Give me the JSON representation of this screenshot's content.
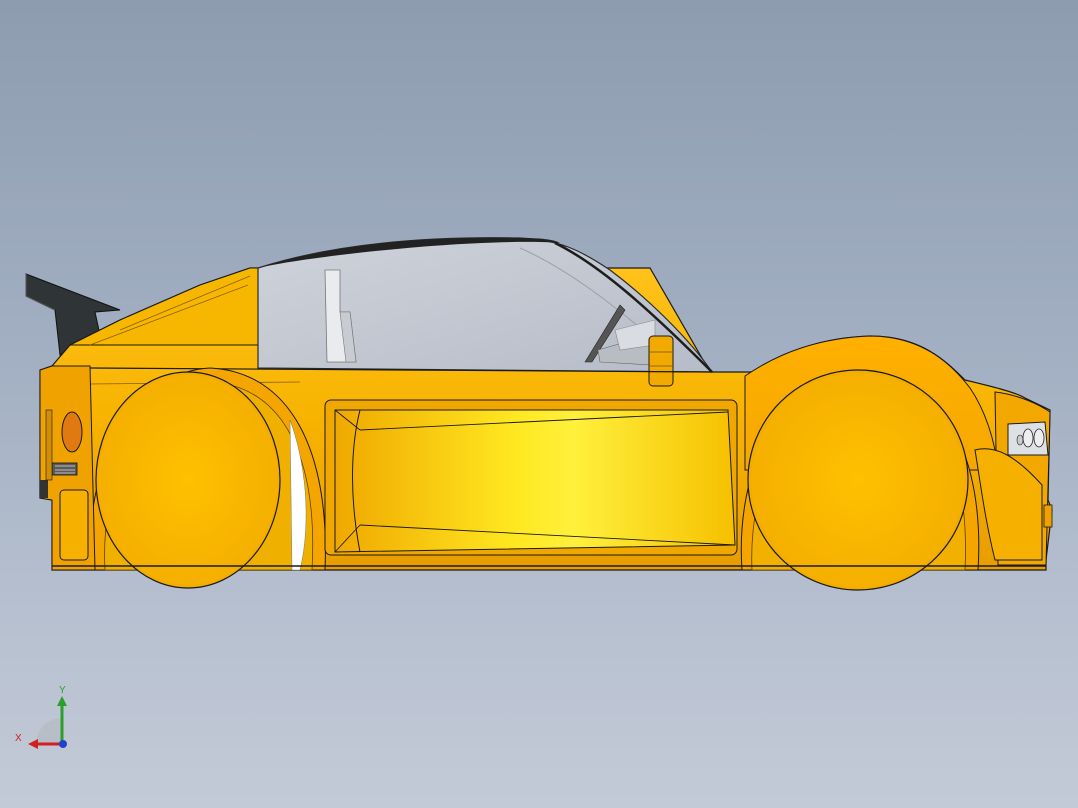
{
  "viewport": {
    "background_top": "#8e9cb0",
    "background_bottom": "#c3cad7"
  },
  "model": {
    "body_color": "#f5b800",
    "highlight_color": "#fff23a",
    "glass_color": "#c3c9d3",
    "wing_color": "#2f3436",
    "edge_color": "#1a1a1a"
  },
  "triad": {
    "x_label": "X",
    "y_label": "Y",
    "x_color": "#d02020",
    "y_color": "#2aa02a",
    "z_color": "#2040d0"
  }
}
